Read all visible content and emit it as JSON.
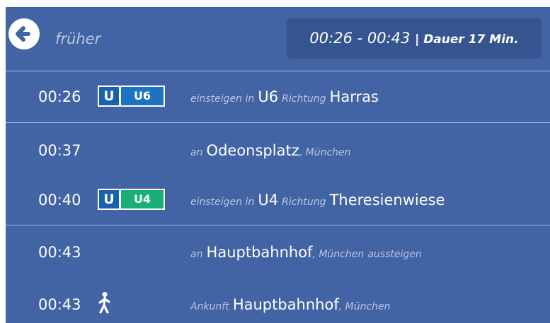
{
  "header": {
    "back_icon": "arrow-left-circle-icon",
    "earlier_label": "früher",
    "trip_time": "00:26 - 00:43",
    "trip_duration": "| Dauer 17 Min."
  },
  "colors": {
    "panel": "#4263a4",
    "header_box": "#36548f",
    "ubahn": "#1761ae",
    "u6": "#1e73c1",
    "u4": "#1aaf77",
    "muted_text": "#b8c6e2"
  },
  "rows": [
    {
      "time": "00:26",
      "badge": {
        "u": "U",
        "line": "U6"
      },
      "prefix": "einsteigen in",
      "line": "U6",
      "direction_label": "Richtung",
      "direction": "Harras"
    },
    {
      "time": "00:37",
      "prefix": "an",
      "station": "Odeonsplatz",
      "city": ", München"
    },
    {
      "time": "00:40",
      "badge": {
        "u": "U",
        "line": "U4"
      },
      "prefix": "einsteigen in",
      "line": "U4",
      "direction_label": "Richtung",
      "direction": "Theresienwiese"
    },
    {
      "time": "00:43",
      "prefix": "an",
      "station": "Hauptbahnhof",
      "city": ", München",
      "suffix": "aussteigen"
    },
    {
      "time": "00:43",
      "icon": "walking-person-icon",
      "prefix": "Ankunft",
      "station": "Hauptbahnhof",
      "city": ", München"
    }
  ]
}
